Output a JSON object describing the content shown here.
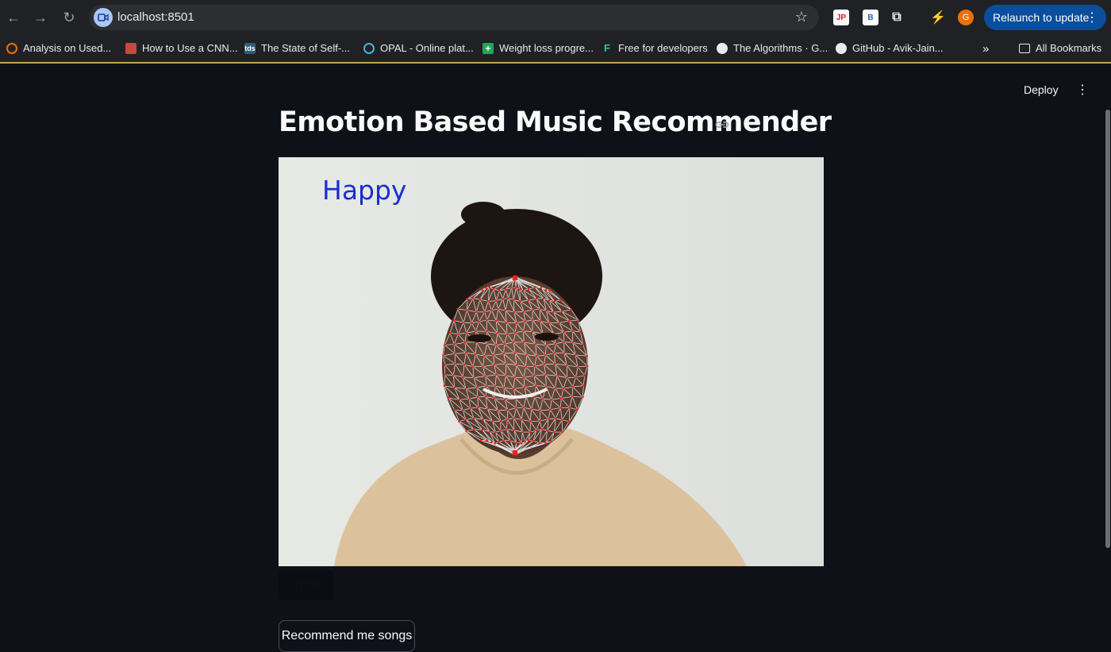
{
  "browser": {
    "url": "localhost:8501",
    "relaunch_label": "Relaunch to update",
    "profile_initial": "G",
    "bookmarks": [
      "Analysis on Used...",
      "How to Use a CNN...",
      "The State of Self-...",
      "OPAL - Online plat...",
      "Weight loss progre...",
      "Free for developers",
      "The Algorithms · G...",
      "GitHub - Avik-Jain...",
      "All Bookmarks"
    ],
    "overflow_label": "»"
  },
  "app": {
    "deploy_label": "Deploy",
    "title": "Emotion Based Music Recommender",
    "video": {
      "emotion_label": "Happy"
    },
    "stop_label": "STOP",
    "recommend_label": "Recommend me songs"
  },
  "colors": {
    "app_background": "#0e1117",
    "chrome_background": "#202124",
    "relaunch_button": "#0a4e9c",
    "emotion_text": "#1a2ecf",
    "landmark_points": "#ff1e1e"
  }
}
